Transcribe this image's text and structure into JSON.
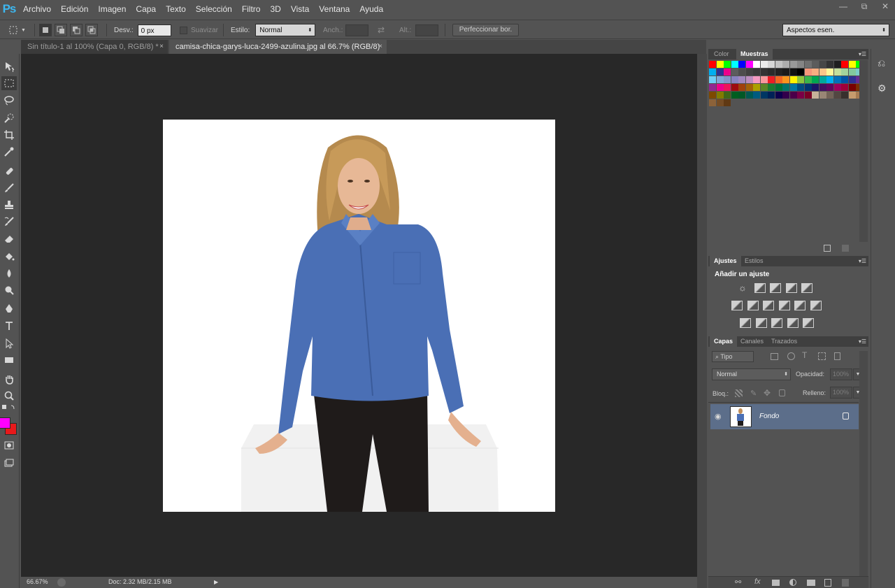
{
  "app": {
    "logo": "Ps"
  },
  "menu": [
    "Archivo",
    "Edición",
    "Imagen",
    "Capa",
    "Texto",
    "Selección",
    "Filtro",
    "3D",
    "Vista",
    "Ventana",
    "Ayuda"
  ],
  "window_controls": {
    "minimize": "—",
    "restore": "⧉",
    "close": "✕"
  },
  "options": {
    "feather_label": "Desv.:",
    "feather_value": "0 px",
    "antialias_label": "Suavizar",
    "style_label": "Estilo:",
    "style_value": "Normal",
    "width_label": "Anch.:",
    "height_label": "Alt.:",
    "refine_button": "Perfeccionar bor.",
    "workspace_value": "Aspectos esen."
  },
  "tabs": [
    {
      "label": "Sin título-1 al 100% (Capa 0, RGB/8) *"
    },
    {
      "label": "camisa-chica-garys-luca-2499-azulina.jpg al 66.7% (RGB/8)"
    }
  ],
  "tab_close": "×",
  "status": {
    "zoom": "66.67%",
    "doc": "Doc: 2.32 MB/2.15 MB"
  },
  "panels": {
    "color_tab": "Color",
    "swatches_tab": "Muestras",
    "adjustments_tab": "Ajustes",
    "styles_tab": "Estilos",
    "adjustments_title": "Añadir un ajuste",
    "layers_tab": "Capas",
    "channels_tab": "Canales",
    "paths_tab": "Trazados",
    "filter_kind": "Tipo",
    "blend_mode": "Normal",
    "opacity_label": "Opacidad:",
    "opacity_value": "100%",
    "lock_label": "Bloq.:",
    "fill_label": "Relleno:",
    "fill_value": "100%",
    "layer_name": "Fondo"
  },
  "colors": {
    "foreground": "#ff00ff",
    "background": "#e8191b",
    "ps_blue": "#3db7f0",
    "layer_selected": "#5c6e8a"
  },
  "swatches": [
    [
      "#ff0000",
      "#ffff00",
      "#00ff00",
      "#00ffff",
      "#0000ff",
      "#ff00ff",
      "#ffffff",
      "#ebebeb",
      "#d6d6d6",
      "#c2c2c2",
      "#adadad",
      "#999999",
      "#858585",
      "#707070",
      "#5c5c5c",
      "#474747",
      "#333333",
      "#1f1f1f",
      "#ff0000",
      "#ffff00",
      "#00ff00"
    ],
    [
      "#00aeef",
      "#2e3192",
      "#ec008c",
      "#5c5c5c",
      "#4d4d4d",
      "#414141",
      "#3a3a3a",
      "#333333",
      "#2b2b2b",
      "#222222",
      "#1a1a1a",
      "#111111",
      "#000000",
      "#f7977a",
      "#f9ad81",
      "#fdc68a",
      "#fff79a",
      "#c4df9b",
      "#a3d39c",
      "#82ca9d",
      "#7bcdc8"
    ],
    [
      "#6ecff6",
      "#7ea7d8",
      "#8493ca",
      "#8882be",
      "#a187be",
      "#bc8dbf",
      "#f49ac2",
      "#f6989d",
      "#ed1c24",
      "#f26522",
      "#f7941d",
      "#fff200",
      "#8dc63f",
      "#39b54a",
      "#00a651",
      "#00a99d",
      "#00aeef",
      "#0072bc",
      "#0054a6",
      "#2e3192",
      "#662d91"
    ],
    [
      "#92278f",
      "#ec008c",
      "#ed145b",
      "#9e0b0f",
      "#a0410d",
      "#a36209",
      "#aba000",
      "#598527",
      "#1a7b30",
      "#007236",
      "#00746b",
      "#0076a3",
      "#004b80",
      "#003471",
      "#1b1464",
      "#440e62",
      "#630460",
      "#9e005d",
      "#9e0039",
      "#790000",
      "#7b2e00"
    ],
    [
      "#7d4900",
      "#827b00",
      "#406618",
      "#005e20",
      "#005826",
      "#005952",
      "#005b7f",
      "#003663",
      "#002157",
      "#0d004c",
      "#32004b",
      "#4b0049",
      "#7b0046",
      "#7a0026",
      "#c7b299",
      "#998675",
      "#736357",
      "#534741",
      "#37302d",
      "#c69c6d",
      "#a67c52"
    ],
    [
      "#8c6239",
      "#754c24",
      "#603913"
    ]
  ]
}
